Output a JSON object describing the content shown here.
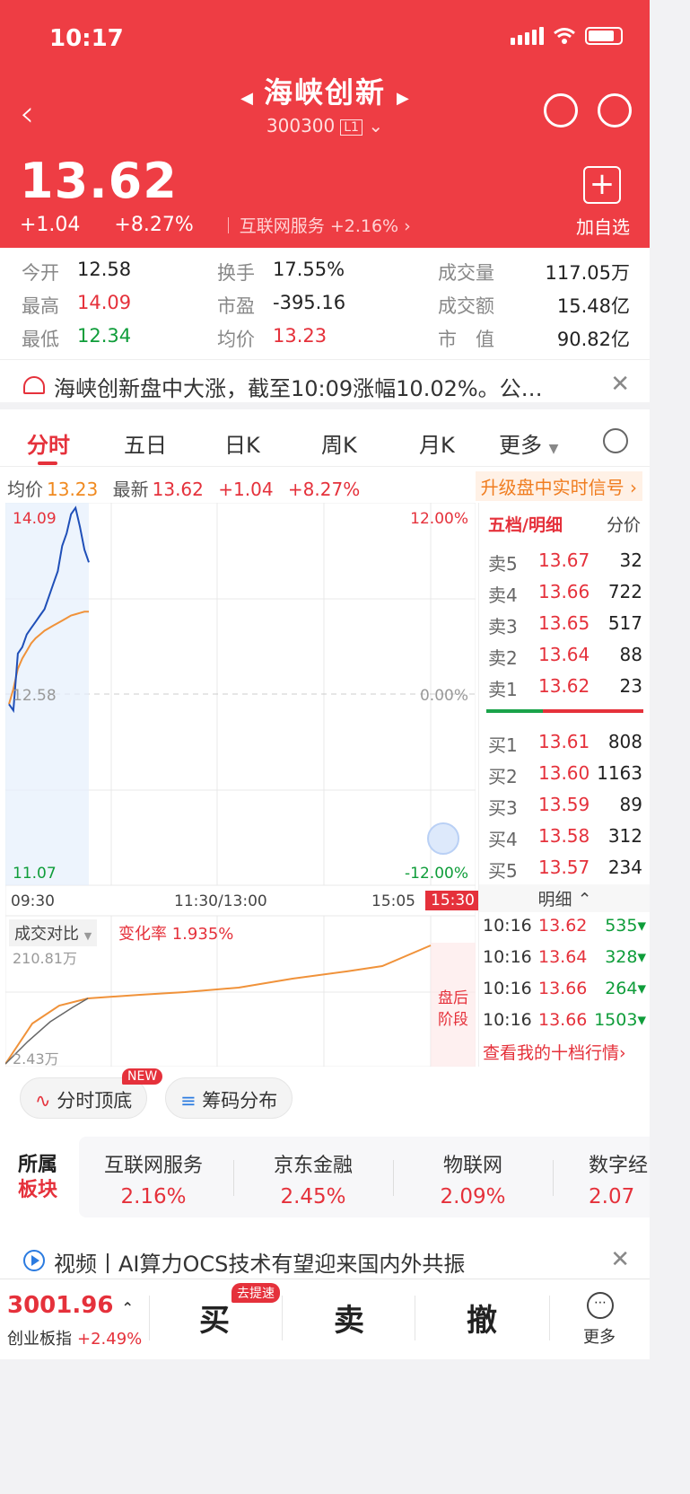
{
  "status": {
    "time": "10:17"
  },
  "header": {
    "title": "海峡创新",
    "code": "300300",
    "level": "L1",
    "price": "13.62",
    "change": "+1.04",
    "change_pct": "+8.27%",
    "sector": "互联网服务",
    "sector_pct": "+2.16%",
    "add_label": "加自选"
  },
  "stats": {
    "open_k": "今开",
    "open_v": "12.58",
    "high_k": "最高",
    "high_v": "14.09",
    "low_k": "最低",
    "low_v": "12.34",
    "turnover_k": "换手",
    "turnover_v": "17.55%",
    "pe_k": "市盈",
    "pe_v": "-395.16",
    "avg_k": "均价",
    "avg_v": "13.23",
    "vol_k": "成交量",
    "vol_v": "117.05万",
    "amt_k": "成交额",
    "amt_v": "15.48亿",
    "cap_k": "市　值",
    "cap_v": "90.82亿"
  },
  "news": {
    "text": "海峡创新盘中大涨，截至10:09涨幅10.02%。公…"
  },
  "tabs": [
    "分时",
    "五日",
    "日K",
    "周K",
    "月K",
    "更多"
  ],
  "info": {
    "avg_label": "均价",
    "avg_value": "13.23",
    "last_label": "最新",
    "last_value": "13.62",
    "change": "+1.04",
    "pct": "+8.27%",
    "upgrade": "升级盘中实时信号"
  },
  "chart_data": {
    "type": "line",
    "title": "",
    "y_high": "14.09",
    "y_mid": "12.58",
    "y_low": "11.07",
    "pct_high": "12.00%",
    "pct_mid": "0.00%",
    "pct_low": "-12.00%",
    "x_ticks": [
      "09:30",
      "11:30/13:00",
      "15:05",
      "15:30"
    ],
    "ylim": [
      11.07,
      14.09
    ],
    "series": [],
    "price": [
      12.5,
      12.45,
      12.9,
      12.95,
      13.05,
      13.1,
      13.15,
      13.2,
      13.25,
      13.35,
      13.45,
      13.55,
      13.75,
      13.85,
      14.0,
      14.05,
      13.9,
      13.72,
      13.62
    ],
    "avg": [
      12.5,
      12.62,
      12.78,
      12.86,
      12.92,
      12.98,
      13.02,
      13.05,
      13.08,
      13.1,
      13.12,
      13.14,
      13.16,
      13.18,
      13.2,
      13.21,
      13.22,
      13.23,
      13.23
    ]
  },
  "volume": {
    "label": "成交对比",
    "rate_label": "变化率",
    "rate_value": "1.935%",
    "top": "210.81万",
    "bottom": "2.43万",
    "after_hours": "盘后阶段"
  },
  "orderbook": {
    "head": "五档/明细",
    "head2": "分价",
    "asks": [
      {
        "label": "卖5",
        "price": "13.67",
        "qty": "32"
      },
      {
        "label": "卖4",
        "price": "13.66",
        "qty": "722"
      },
      {
        "label": "卖3",
        "price": "13.65",
        "qty": "517"
      },
      {
        "label": "卖2",
        "price": "13.64",
        "qty": "88"
      },
      {
        "label": "卖1",
        "price": "13.62",
        "qty": "23"
      }
    ],
    "bids": [
      {
        "label": "买1",
        "price": "13.61",
        "qty": "808"
      },
      {
        "label": "买2",
        "price": "13.60",
        "qty": "1163"
      },
      {
        "label": "买3",
        "price": "13.59",
        "qty": "89"
      },
      {
        "label": "买4",
        "price": "13.58",
        "qty": "312"
      },
      {
        "label": "买5",
        "price": "13.57",
        "qty": "234"
      }
    ],
    "detail_head": "明细",
    "trades": [
      {
        "time": "10:16",
        "price": "13.62",
        "qty": "535"
      },
      {
        "time": "10:16",
        "price": "13.64",
        "qty": "328"
      },
      {
        "time": "10:16",
        "price": "13.66",
        "qty": "264"
      },
      {
        "time": "10:16",
        "price": "13.66",
        "qty": "1503"
      }
    ],
    "my_level": "查看我的十档行情"
  },
  "pills": {
    "p1": "分时顶底",
    "p2": "筹码分布",
    "new": "NEW"
  },
  "sectors": {
    "label_1": "所属",
    "label_2": "板块",
    "items": [
      {
        "name": "互联网服务",
        "pct": "2.16%"
      },
      {
        "name": "京东金融",
        "pct": "2.45%"
      },
      {
        "name": "物联网",
        "pct": "2.09%"
      },
      {
        "name": "数字经",
        "pct": "2.07"
      }
    ]
  },
  "video": {
    "text": "视频丨AI算力OCS技术有望迎来国内外共振"
  },
  "bottom": {
    "index_value": "3001.96",
    "index_name": "创业板指",
    "index_pct": "+2.49%",
    "buy": "买",
    "sell": "卖",
    "cancel": "撤",
    "fast": "去提速",
    "more": "更多"
  }
}
